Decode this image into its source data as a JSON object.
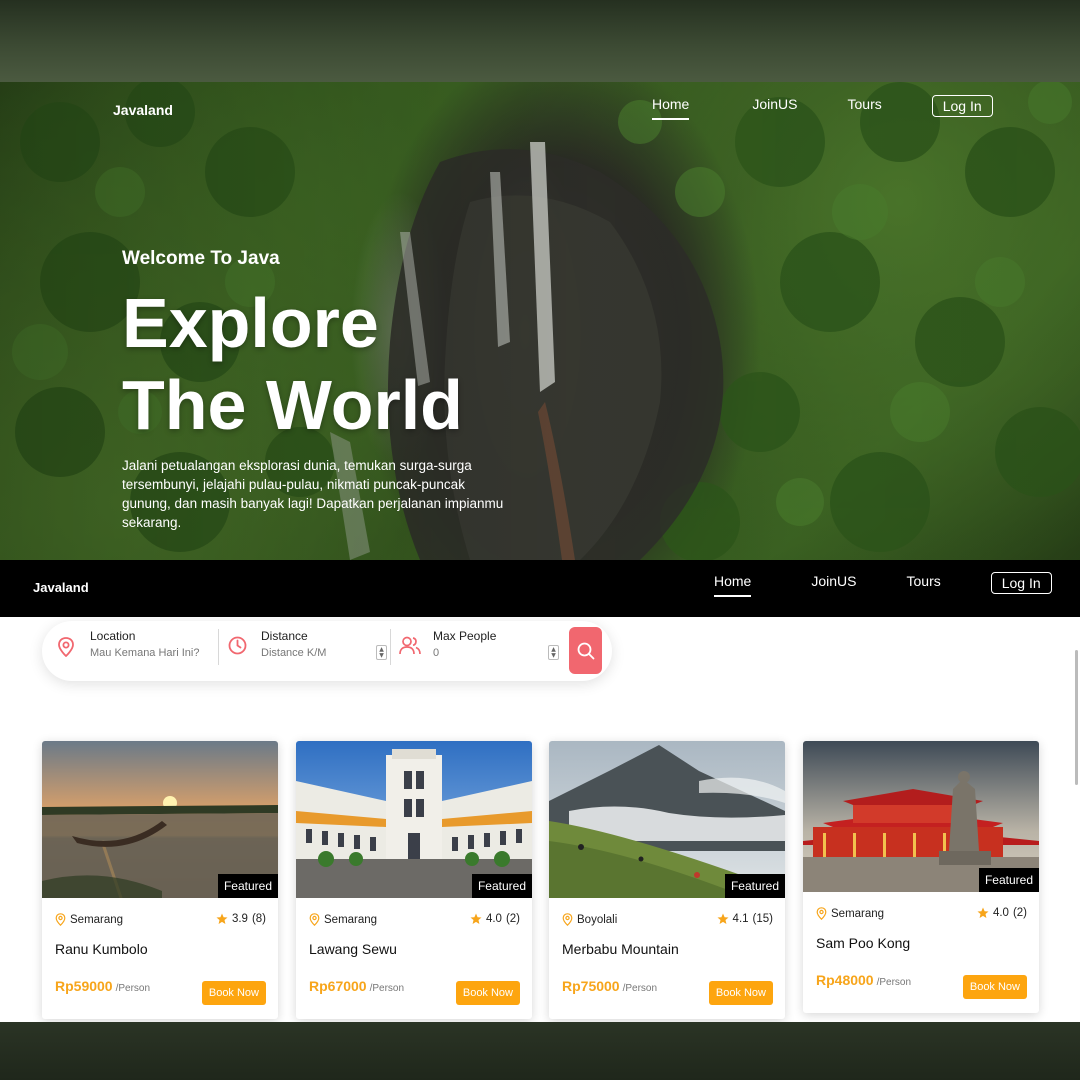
{
  "brand": "Javaland",
  "nav": {
    "items": [
      {
        "label": "Home",
        "active": true
      },
      {
        "label": "JoinUS",
        "active": false
      },
      {
        "label": "Tours",
        "active": false
      }
    ],
    "login_label": "Log In"
  },
  "hero": {
    "welcome": "Welcome To Java",
    "title_line1": "Explore",
    "title_line2": "The World",
    "description": "Jalani petualangan eksplorasi dunia, temukan surga-surga tersembunyi, jelajahi pulau-pulau, nikmati puncak-puncak gunung, dan masih banyak lagi! Dapatkan perjalanan impianmu sekarang."
  },
  "search": {
    "location": {
      "label": "Location",
      "placeholder": "Mau Kemana Hari Ini?",
      "icon": "map-pin-icon"
    },
    "distance": {
      "label": "Distance",
      "placeholder": "Distance K/M",
      "icon": "clock-icon"
    },
    "max_people": {
      "label": "Max People",
      "value": "0",
      "icon": "users-icon"
    },
    "button_icon": "search-icon"
  },
  "tours": [
    {
      "location": "Semarang",
      "rating": "3.9",
      "reviews": "(8)",
      "name": "Ranu Kumbolo",
      "price": "Rp59000",
      "unit": "/Person",
      "badge": "Featured",
      "book_label": "Book Now"
    },
    {
      "location": "Semarang",
      "rating": "4.0",
      "reviews": "(2)",
      "name": "Lawang Sewu",
      "price": "Rp67000",
      "unit": "/Person",
      "badge": "Featured",
      "book_label": "Book Now"
    },
    {
      "location": "Boyolali",
      "rating": "4.1",
      "reviews": "(15)",
      "name": "Merbabu Mountain",
      "price": "Rp75000",
      "unit": "/Person",
      "badge": "Featured",
      "book_label": "Book Now"
    },
    {
      "location": "Semarang",
      "rating": "4.0",
      "reviews": "(2)",
      "name": "Sam Poo Kong",
      "price": "Rp48000",
      "unit": "/Person",
      "badge": "Featured",
      "book_label": "Book Now"
    }
  ],
  "colors": {
    "accent": "#fda50f",
    "price": "#f7a51b",
    "search_button": "#f1676f",
    "icon_red": "#f1676f",
    "star": "#f7a51b"
  }
}
